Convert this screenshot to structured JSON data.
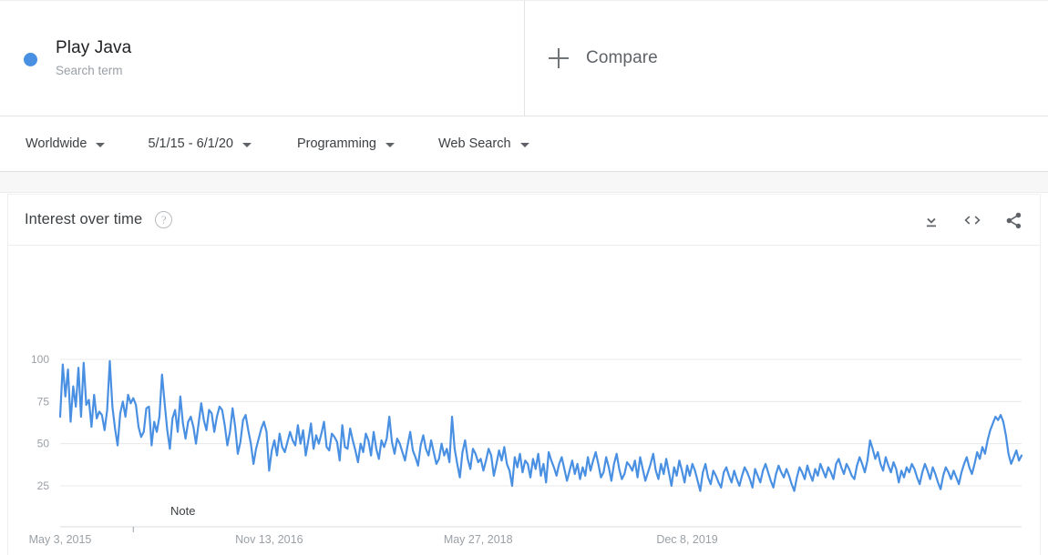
{
  "term": {
    "title": "Play Java",
    "subtitle": "Search term",
    "dot_color": "#4a90e2"
  },
  "compare": {
    "label": "Compare",
    "icon": "plus-icon"
  },
  "filters": [
    {
      "label": "Worldwide",
      "name": "location"
    },
    {
      "label": "5/1/15 - 6/1/20",
      "name": "time-range"
    },
    {
      "label": "Programming",
      "name": "category"
    },
    {
      "label": "Web Search",
      "name": "search-type"
    }
  ],
  "card": {
    "title": "Interest over time",
    "help_glyph": "?",
    "actions": [
      {
        "name": "download-icon"
      },
      {
        "name": "embed-code-icon"
      },
      {
        "name": "share-icon"
      }
    ]
  },
  "chart_data": {
    "type": "line",
    "title": "Interest over time",
    "xlabel": "",
    "ylabel": "",
    "ylim": [
      0,
      100
    ],
    "yticks": [
      25,
      50,
      75,
      100
    ],
    "grid": true,
    "legend_position": "none",
    "line_color": "#4a90e2",
    "annotations": [
      {
        "label": "Note",
        "x_index": 28
      }
    ],
    "xtick_labels": [
      "May 3, 2015",
      "Nov 13, 2016",
      "May 27, 2018",
      "Dec 8, 2019"
    ],
    "xtick_indices": [
      0,
      80,
      160,
      240
    ],
    "series": [
      {
        "name": "Play Java",
        "values": [
          66,
          97,
          78,
          94,
          63,
          84,
          72,
          95,
          66,
          98,
          73,
          76,
          60,
          79,
          65,
          69,
          67,
          58,
          70,
          99,
          72,
          59,
          49,
          68,
          75,
          66,
          79,
          74,
          77,
          73,
          60,
          54,
          57,
          71,
          72,
          49,
          63,
          57,
          66,
          91,
          74,
          58,
          47,
          65,
          70,
          57,
          78,
          62,
          53,
          63,
          66,
          60,
          50,
          62,
          74,
          64,
          58,
          70,
          68,
          57,
          66,
          72,
          70,
          61,
          49,
          57,
          71,
          60,
          44,
          51,
          64,
          67,
          58,
          50,
          38,
          47,
          53,
          59,
          63,
          57,
          34,
          46,
          52,
          43,
          56,
          48,
          45,
          51,
          57,
          52,
          49,
          61,
          50,
          58,
          43,
          52,
          62,
          47,
          55,
          50,
          56,
          63,
          48,
          46,
          56,
          54,
          51,
          40,
          61,
          48,
          47,
          59,
          52,
          46,
          39,
          50,
          45,
          56,
          52,
          43,
          57,
          47,
          41,
          52,
          48,
          53,
          66,
          51,
          44,
          53,
          50,
          45,
          40,
          49,
          57,
          46,
          42,
          37,
          49,
          55,
          47,
          43,
          52,
          45,
          38,
          41,
          50,
          43,
          47,
          39,
          66,
          47,
          38,
          30,
          45,
          52,
          41,
          35,
          47,
          44,
          39,
          41,
          34,
          40,
          47,
          43,
          31,
          38,
          46,
          40,
          48,
          38,
          34,
          25,
          42,
          36,
          44,
          33,
          40,
          38,
          30,
          41,
          35,
          44,
          31,
          38,
          27,
          45,
          40,
          36,
          31,
          38,
          42,
          35,
          28,
          34,
          40,
          32,
          38,
          29,
          36,
          31,
          42,
          34,
          40,
          45,
          38,
          30,
          33,
          42,
          36,
          28,
          38,
          44,
          35,
          29,
          32,
          39,
          37,
          34,
          40,
          30,
          42,
          35,
          28,
          33,
          38,
          44,
          34,
          29,
          38,
          32,
          41,
          33,
          25,
          36,
          31,
          40,
          34,
          27,
          37,
          31,
          38,
          34,
          28,
          22,
          33,
          38,
          30,
          26,
          34,
          31,
          27,
          24,
          33,
          36,
          31,
          27,
          34,
          29,
          25,
          31,
          36,
          33,
          29,
          24,
          35,
          31,
          27,
          34,
          38,
          33,
          28,
          24,
          32,
          37,
          33,
          30,
          35,
          31,
          26,
          22,
          30,
          36,
          33,
          29,
          37,
          32,
          28,
          35,
          31,
          38,
          34,
          30,
          36,
          33,
          29,
          38,
          41,
          36,
          32,
          38,
          35,
          31,
          29,
          37,
          42,
          38,
          33,
          40,
          52,
          47,
          41,
          45,
          38,
          34,
          42,
          37,
          33,
          39,
          35,
          27,
          34,
          30,
          36,
          33,
          38,
          35,
          30,
          26,
          33,
          38,
          34,
          29,
          36,
          32,
          27,
          23,
          31,
          36,
          33,
          29,
          34,
          30,
          26,
          33,
          38,
          42,
          36,
          32,
          38,
          45,
          41,
          48,
          44,
          52,
          58,
          62,
          66,
          64,
          67,
          63,
          55,
          44,
          38,
          42,
          46,
          40,
          43
        ]
      }
    ]
  }
}
